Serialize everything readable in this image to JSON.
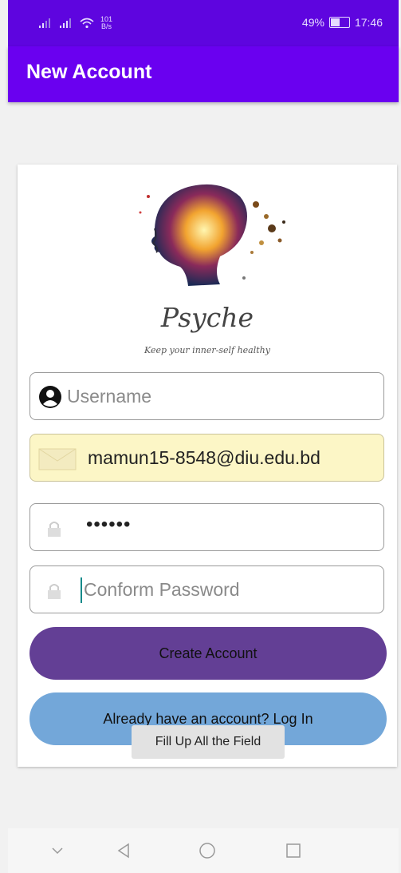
{
  "status_bar": {
    "net_speed_value": "101",
    "net_speed_unit": "B/s",
    "battery": "49%",
    "battery_level": 0.49,
    "time": "17:46"
  },
  "app_bar": {
    "title": "New Account"
  },
  "logo": {
    "name": "Psyche",
    "tagline": "Keep your inner-self healthy"
  },
  "form": {
    "username": {
      "value": "",
      "placeholder": "Username",
      "icon": "account-circle-icon"
    },
    "email": {
      "value": "mamun15-8548@diu.edu.bd",
      "icon": "envelope-icon",
      "autofilled": true
    },
    "password": {
      "value": "••••••",
      "icon": "lock-icon"
    },
    "confirm_password": {
      "value": "",
      "placeholder": "Conform Password",
      "icon": "lock-icon"
    }
  },
  "buttons": {
    "create_account": "Create Account",
    "login": "Already have an account? Log In"
  },
  "toast": {
    "message": "Fill Up All the Field"
  },
  "colors": {
    "status_bar": "#5e05df",
    "app_bar": "#6a00f0",
    "create_button": "#633f95",
    "login_button": "#73a7d9",
    "autofill_bg": "#fcf6c6"
  }
}
